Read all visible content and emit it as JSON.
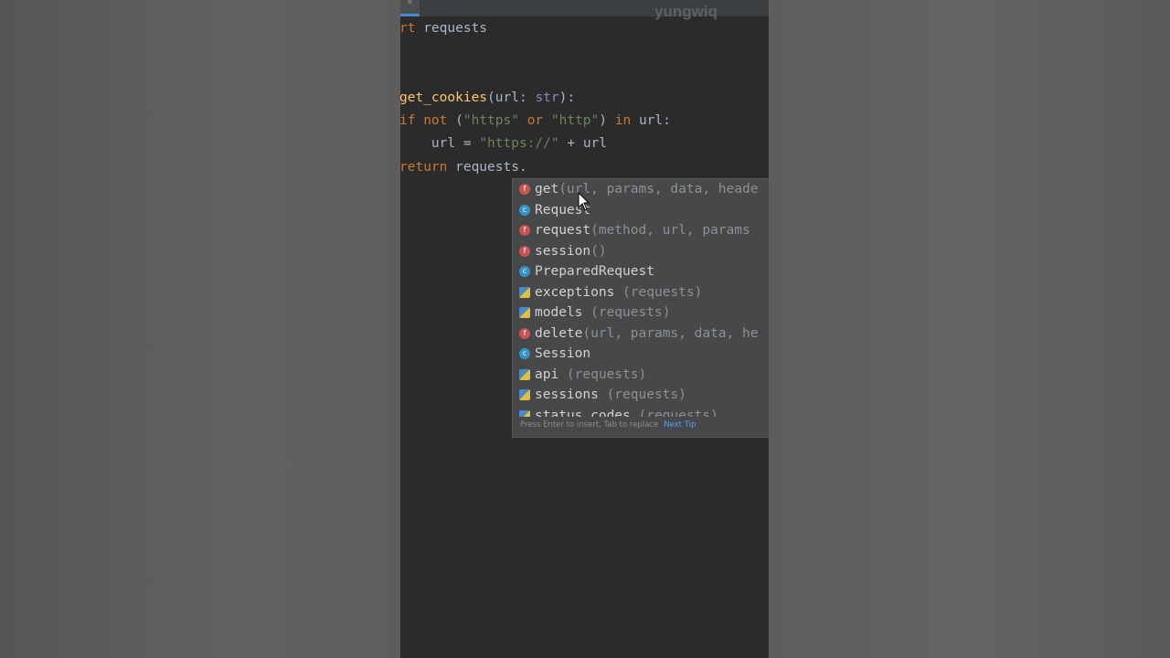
{
  "watermark": "yungwiq",
  "tab": {
    "close_glyph": "×"
  },
  "code": {
    "line1": {
      "partial_kw": "rt",
      "module": " requests"
    },
    "line3": {
      "func_name": "get_cookies",
      "open": "(",
      "param": "url",
      "colon": ": ",
      "type": "str",
      "close": "):"
    },
    "line4": {
      "kw_if": "if",
      "kw_not": " not",
      "open": " (",
      "str1": "\"https\"",
      "kw_or": " or ",
      "str2": "\"http\"",
      "close": ")",
      "kw_in": " in",
      "rest": " url:"
    },
    "line5": {
      "indent": "    ",
      "lhs": "url = ",
      "str": "\"https://\"",
      "rest": " + url"
    },
    "line6": {
      "kw_return": "return",
      "rest": " requests."
    }
  },
  "completion": {
    "items": [
      {
        "kind": "f",
        "name": "get",
        "sig": "(url, params, data, heade"
      },
      {
        "kind": "c",
        "name": "Request",
        "sig": ""
      },
      {
        "kind": "f",
        "name": "request",
        "sig": "(method, url, params"
      },
      {
        "kind": "f",
        "name": "session",
        "sig": "()"
      },
      {
        "kind": "c",
        "name": "PreparedRequest",
        "sig": ""
      },
      {
        "kind": "m",
        "name": "exceptions",
        "sig": " (requests)"
      },
      {
        "kind": "m",
        "name": "models",
        "sig": " (requests)"
      },
      {
        "kind": "f",
        "name": "delete",
        "sig": "(url, params, data, he"
      },
      {
        "kind": "c",
        "name": "Session",
        "sig": ""
      },
      {
        "kind": "m",
        "name": "api",
        "sig": " (requests)"
      },
      {
        "kind": "m",
        "name": "sessions",
        "sig": " (requests)"
      },
      {
        "kind": "m",
        "name": "status_codes",
        "sig": " (requests)"
      }
    ],
    "hint_text": "Press Enter to insert, Tab to replace",
    "hint_link": "Next Tip"
  },
  "colors": {
    "keyword": "#cc7832",
    "function_name": "#ffc66d",
    "string": "#6a8759",
    "identifier": "#a9b7c6",
    "editor_bg": "#2b2b2b",
    "popup_bg": "#46484a",
    "link": "#589df6"
  }
}
